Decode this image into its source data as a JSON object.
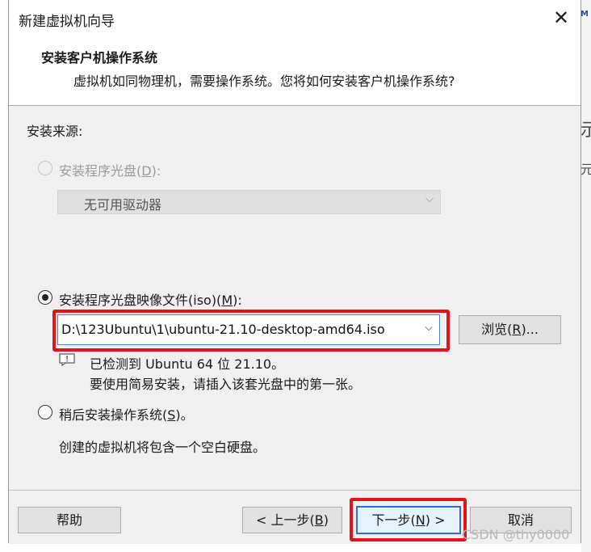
{
  "window": {
    "title": "新建虚拟机向导",
    "close_glyph": "✕"
  },
  "header": {
    "title": "安装客户机操作系统",
    "subtitle": "虚拟机如同物理机，需要操作系统。您将如何安装客户机操作系统?"
  },
  "install_source_label": "安装来源:",
  "option_disc": {
    "text": "安装程序光盘(",
    "key": "D",
    "suffix": "):",
    "selected": false,
    "enabled": false
  },
  "drive_select": {
    "value": "无可用驱动器"
  },
  "option_iso": {
    "text": "安装程序光盘映像文件(iso)(",
    "key": "M",
    "suffix": "):",
    "selected": true
  },
  "iso_path": {
    "value": "D:\\123Ubuntu\\1\\ubuntu-21.10-desktop-amd64.iso"
  },
  "browse_button": {
    "text": "浏览(",
    "key": "R",
    "suffix": ")..."
  },
  "detect": {
    "line1": "已检测到 Ubuntu 64 位 21.10。",
    "line2": "要使用简易安装，请插入该套光盘中的第一张。"
  },
  "option_later": {
    "text": "稍后安装操作系统(",
    "key": "S",
    "suffix": ")。",
    "selected": false
  },
  "later_desc": "创建的虚拟机将包含一个空白硬盘。",
  "footer": {
    "help": "帮助",
    "back": {
      "text": "< 上一步(",
      "key": "B",
      "suffix": ")"
    },
    "next": {
      "text": "下一步(",
      "key": "N",
      "suffix": ") >"
    },
    "cancel": "取消"
  },
  "watermark": "CSDN @thy0000",
  "colors": {
    "highlight": "#e0141a",
    "focus": "#2a6fd6"
  }
}
